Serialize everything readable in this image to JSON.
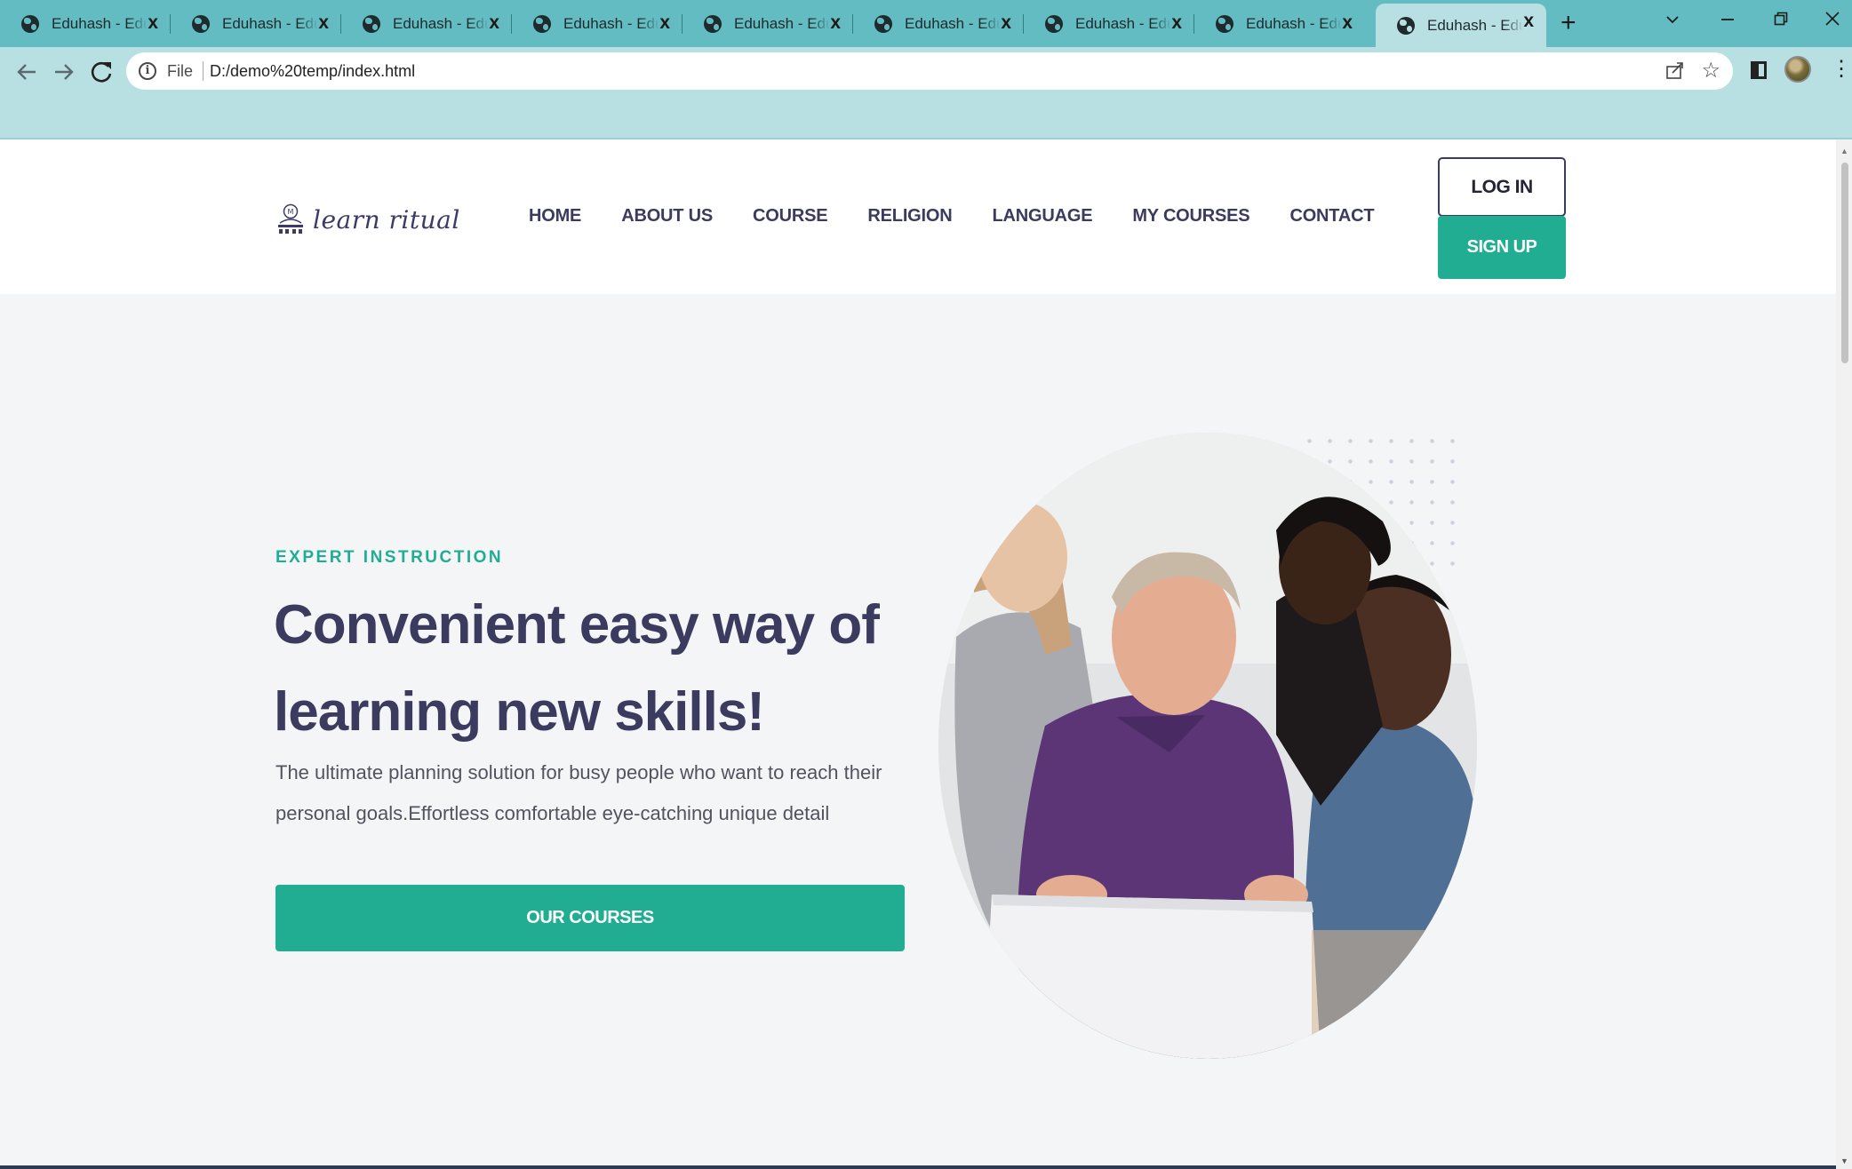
{
  "browser": {
    "tabs": [
      {
        "title": "Eduhash - Educ",
        "active": false
      },
      {
        "title": "Eduhash - Educ",
        "active": false
      },
      {
        "title": "Eduhash - Educ",
        "active": false
      },
      {
        "title": "Eduhash - Educ",
        "active": false
      },
      {
        "title": "Eduhash - Educ",
        "active": false
      },
      {
        "title": "Eduhash - Educ",
        "active": false
      },
      {
        "title": "Eduhash - Educ",
        "active": false
      },
      {
        "title": "Eduhash - Educ",
        "active": false
      },
      {
        "title": "Eduhash - Educ",
        "active": true
      }
    ],
    "close_glyph": "x",
    "new_tab_glyph": "+",
    "address": {
      "scheme_label": "File",
      "url": "D:/demo%20temp/index.html"
    },
    "icons": [
      "back-icon",
      "forward-icon",
      "reload-icon",
      "info-icon",
      "share-icon",
      "bookmark-star-icon",
      "side-panel-icon",
      "profile-avatar",
      "menu-icon"
    ],
    "colors": {
      "tabbar": "#63bcc1",
      "toolbar": "#b8e0e3"
    }
  },
  "site": {
    "logo_text": "learn ritual",
    "nav": [
      "HOME",
      "ABOUT US",
      "COURSE",
      "RELIGION",
      "LANGUAGE",
      "MY COURSES",
      "CONTACT"
    ],
    "login_label": "LOG IN",
    "signup_label": "SIGN UP",
    "colors": {
      "accent": "#21ad92",
      "heading": "#3b3a5f",
      "background": "#f4f5f7"
    }
  },
  "hero": {
    "eyebrow": "EXPERT INSTRUCTION",
    "title": "Convenient easy way of learning new skills!",
    "description": "The ultimate planning solution for busy people who want to reach their personal goals.Effortless comfortable eye-catching unique detail",
    "cta_label": "OUR COURSES",
    "image_subject": "four people smiling at a laptop"
  }
}
